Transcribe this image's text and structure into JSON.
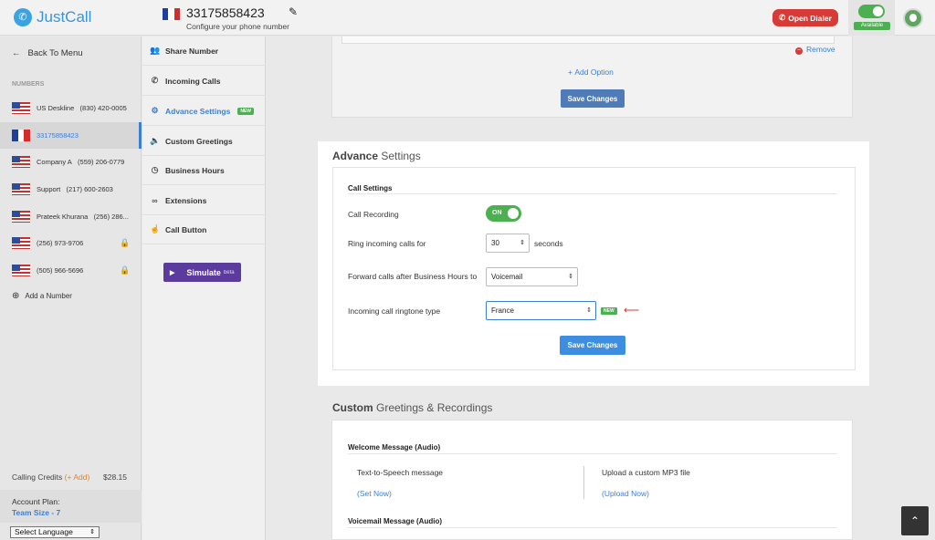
{
  "app": {
    "name": "JustCall"
  },
  "header": {
    "phone_number": "33175858423",
    "configure_text": "Configure your phone number",
    "open_dialer_label": "Open Dialer",
    "availability_label": "Available",
    "flag_colors": [
      "#1f3f99",
      "#ffffff",
      "#d62b2b"
    ]
  },
  "sidebar": {
    "back_label": "Back To Menu",
    "numbers_heading": "NUMBERS",
    "numbers": [
      {
        "name": "US Deskline",
        "number": "(830) 420-0005",
        "flag": "us",
        "locked": false
      },
      {
        "name": "",
        "number": "33175858423",
        "flag": "fr",
        "locked": false
      },
      {
        "name": "Company A",
        "number": "(559) 206-0779",
        "flag": "us",
        "locked": false
      },
      {
        "name": "Support",
        "number": "(217) 600-2603",
        "flag": "us",
        "locked": false
      },
      {
        "name": "Prateek Khurana",
        "number": "(256) 286...",
        "flag": "us",
        "locked": false
      },
      {
        "name": "",
        "number": "(256) 973-9706",
        "flag": "us",
        "locked": true
      },
      {
        "name": "",
        "number": "(505) 966-5696",
        "flag": "us",
        "locked": true
      }
    ],
    "add_number_label": "Add a Number",
    "credits_label": "Calling Credits",
    "credits_add": "(+ Add)",
    "credits_amount": "$28.15",
    "plan_label": "Account Plan:",
    "plan_value": "Team Size - 7",
    "language_select": "Select Language"
  },
  "menu": {
    "items": [
      {
        "label": "Share Number",
        "icon": "users-icon",
        "glyph": "👥"
      },
      {
        "label": "Incoming Calls",
        "icon": "phone-icon",
        "glyph": "✆"
      },
      {
        "label": "Advance Settings",
        "icon": "gear-icon",
        "glyph": "⚙",
        "badge": "NEW",
        "active": true
      },
      {
        "label": "Custom Greetings",
        "icon": "speaker-icon",
        "glyph": "🔈"
      },
      {
        "label": "Business Hours",
        "icon": "clock-icon",
        "glyph": "◷"
      },
      {
        "label": "Extensions",
        "icon": "link-icon",
        "glyph": "⊂⊃"
      },
      {
        "label": "Call Button",
        "icon": "hand-pointer-icon",
        "glyph": "☝"
      }
    ],
    "simulate_label": "Simulate",
    "simulate_beta": "beta"
  },
  "top_panel": {
    "remove_label": "Remove",
    "add_option_label": "Add Option",
    "save_label": "Save Changes"
  },
  "advance": {
    "title_bold": "Advance",
    "title_rest": " Settings",
    "section_heading": "Call Settings",
    "call_recording_label": "Call Recording",
    "call_recording_state": "ON",
    "ring_label": "Ring incoming calls for",
    "ring_value": "30",
    "ring_unit": "seconds",
    "forward_label": "Forward calls after Business Hours to",
    "forward_value": "Voicemail",
    "ringtone_label": "Incoming call ringtone type",
    "ringtone_value": "France",
    "ringtone_badge": "NEW",
    "save_label": "Save Changes"
  },
  "custom": {
    "title_bold": "Custom",
    "title_rest": " Greetings & Recordings",
    "welcome_heading": "Welcome Message (Audio)",
    "tts_label": "Text-to-Speech message",
    "tts_link": "(Set Now)",
    "upload_label": "Upload a custom MP3 file",
    "upload_link": "(Upload Now)",
    "voicemail_heading": "Voicemail Message (Audio)"
  }
}
